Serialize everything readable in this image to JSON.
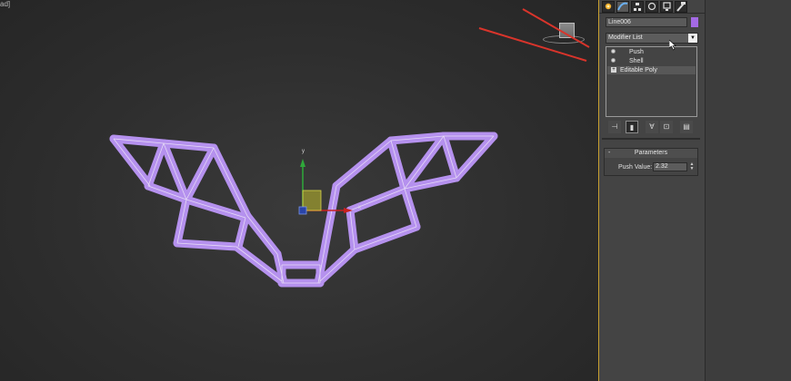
{
  "viewport": {
    "corner_label": "ad]",
    "object_color": "#b591ee",
    "edge_color": "#e6daf6",
    "gizmo": {
      "x_label": "x",
      "y_label": "y"
    }
  },
  "command_panel": {
    "tabs": [
      {
        "icon": "create-icon"
      },
      {
        "icon": "modify-icon"
      },
      {
        "icon": "hierarchy-icon"
      },
      {
        "icon": "motion-icon"
      },
      {
        "icon": "display-icon"
      },
      {
        "icon": "utilities-icon"
      }
    ],
    "active_tab": 1,
    "object_name": "Line006",
    "object_color": "#a46ae4",
    "modifier_list_label": "Modifier List",
    "stack": [
      {
        "label": "Push",
        "kind": "modifier",
        "selected": false
      },
      {
        "label": "Shell",
        "kind": "modifier",
        "selected": false
      },
      {
        "label": "Editable Poly",
        "kind": "base",
        "selected": true
      }
    ],
    "stack_buttons": [
      {
        "icon": "pin-stack-icon"
      },
      {
        "icon": "show-end-result-icon"
      },
      {
        "icon": "make-unique-icon"
      },
      {
        "icon": "remove-modifier-icon"
      },
      {
        "icon": "configure-modifier-sets-icon"
      }
    ],
    "parameters": {
      "title": "Parameters",
      "collapse_symbol": "-",
      "push_value_label": "Push Value:",
      "push_value": "2.32"
    }
  },
  "annotations": {
    "arrow_color": "#d9342b"
  }
}
